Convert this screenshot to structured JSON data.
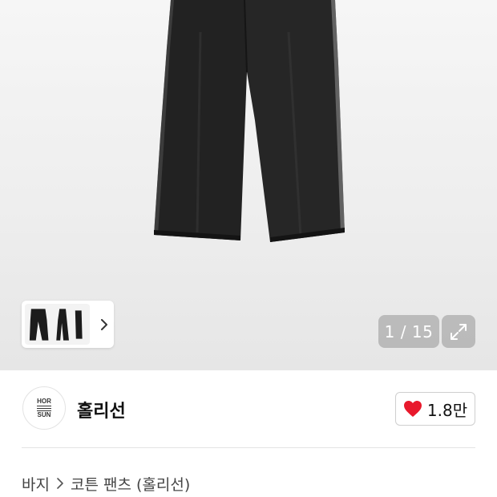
{
  "gallery": {
    "current_page": "1",
    "total_pages": "15",
    "counter_text": "1 / 15",
    "icons": {
      "thumb_next": "chevron-right-icon",
      "expand": "expand-icon"
    }
  },
  "brand": {
    "name": "홀리선",
    "logo_lines": [
      "HOR",
      "SUN"
    ],
    "like_count": "1.8만",
    "like_icon": "heart-icon",
    "like_color": "#e8192c"
  },
  "breadcrumb": {
    "items": [
      "바지",
      "코튼 팬츠 (홀리선)"
    ],
    "separator_icon": "chevron-right-icon"
  }
}
